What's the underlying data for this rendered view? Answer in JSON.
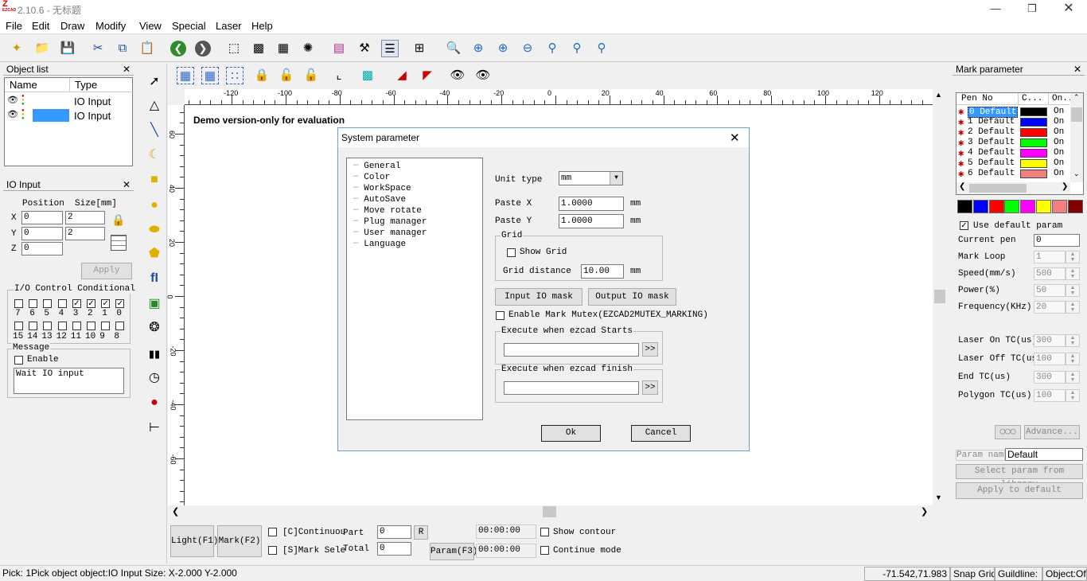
{
  "app": {
    "version": "2.10.6 - 无标题",
    "logo": "EZCAD"
  },
  "menu": [
    "File",
    "Edit",
    "Draw",
    "Modify",
    "View",
    "Special",
    "Laser",
    "Help"
  ],
  "object_list": {
    "title": "Object list",
    "col_name": "Name",
    "col_type": "Type",
    "rows": [
      {
        "type": "IO Input"
      },
      {
        "type": "IO Input"
      }
    ]
  },
  "io_input": {
    "title": "IO Input",
    "position": "Position",
    "size": "Size[mm]",
    "x": "0",
    "xs": "2",
    "y": "0",
    "ys": "2",
    "z": "0",
    "apply": "Apply",
    "io_title": "I/O Control Conditional",
    "bits_top": [
      "7",
      "6",
      "5",
      "4",
      "3",
      "2",
      "1",
      "0"
    ],
    "bits_bottom": [
      "15",
      "14",
      "13",
      "12",
      "11",
      "10",
      "9",
      "8"
    ],
    "message": "Message",
    "enable": "Enable",
    "wait": "Wait IO input"
  },
  "canvas": {
    "demo": "Demo version-only for evaluation",
    "ruler_h": [
      "-120",
      "-100",
      "-80",
      "-60",
      "-40",
      "-20",
      "0",
      "20",
      "40",
      "60",
      "80",
      "100",
      "120"
    ],
    "ruler_v": [
      "60",
      "40",
      "20",
      "0",
      "-20",
      "-40",
      "-60"
    ]
  },
  "dialog": {
    "title": "System parameter",
    "tree": [
      "General",
      "Color",
      "WorkSpace",
      "AutoSave",
      "Move rotate",
      "Plug manager",
      "User manager",
      "Language"
    ],
    "unit_type": "Unit type",
    "unit_val": "mm",
    "paste_x": "Paste X",
    "paste_x_val": "1.0000",
    "paste_y": "Paste Y",
    "paste_y_val": "1.0000",
    "mm": "mm",
    "grid": "Grid",
    "show_grid": "Show Grid",
    "grid_dist": "Grid distance",
    "grid_dist_val": "10.00",
    "input_io": "Input IO mask",
    "output_io": "Output IO mask",
    "mutex": "Enable Mark Mutex(EZCAD2MUTEX_MARKING)",
    "exec_start": "Execute when ezcad Starts",
    "exec_finish": "Execute when ezcad finish",
    "browse": ">>",
    "ok": "Ok",
    "cancel": "Cancel"
  },
  "bottom": {
    "light": "Light(F1)",
    "mark": "Mark(F2)",
    "continuous": "[C]Continuou",
    "part": "Part",
    "part_val": "0",
    "r": "R",
    "mark_sel": "[S]Mark Sele",
    "total": "Total",
    "total_val": "0",
    "param": "Param(F3)",
    "time1": "00:00:00",
    "time2": "00:00:00",
    "show_contour": "Show contour",
    "continue_mode": "Continue mode"
  },
  "mark_param": {
    "title": "Mark parameter",
    "col_pen": "Pen No",
    "col_c": "C...",
    "col_on": "On...",
    "pens": [
      {
        "no": "0 Default",
        "color": "#000000",
        "on": "On"
      },
      {
        "no": "1 Default",
        "color": "#0000ff",
        "on": "On"
      },
      {
        "no": "2 Default",
        "color": "#ff0000",
        "on": "On"
      },
      {
        "no": "3 Default",
        "color": "#00ff00",
        "on": "On"
      },
      {
        "no": "4 Default",
        "color": "#ff00ff",
        "on": "On"
      },
      {
        "no": "5 Default",
        "color": "#ffff00",
        "on": "On"
      },
      {
        "no": "6 Default",
        "color": "#f08080",
        "on": "On"
      }
    ],
    "palette": [
      "#000000",
      "#0000ff",
      "#ff0000",
      "#00ff00",
      "#ff00ff",
      "#ffff00",
      "#f08080",
      "#800000"
    ],
    "use_default": "Use default param",
    "current_pen": "Current pen",
    "current_pen_val": "0",
    "fields": [
      {
        "label": "Mark Loop",
        "val": "1"
      },
      {
        "label": "Speed(mm/s)",
        "val": "500"
      },
      {
        "label": "Power(%)",
        "val": "50"
      },
      {
        "label": "Frequency(KHz)",
        "val": "20"
      }
    ],
    "fields2": [
      {
        "label": "Laser On TC(us)",
        "val": "300"
      },
      {
        "label": "Laser Off TC(us",
        "val": "100"
      },
      {
        "label": "End TC(us)",
        "val": "300"
      },
      {
        "label": "Polygon TC(us)",
        "val": "100"
      }
    ],
    "advance": "Advance...",
    "param_name": "Param name",
    "param_name_val": "Default",
    "select_lib": "Select param from library",
    "apply_default": "Apply to default"
  },
  "status": {
    "pick": "Pick: 1Pick object object:IO Input Size: X-2.000 Y-2.000",
    "coords": "-71.542,71.983",
    "snap": "Snap Grid",
    "guide": "Guildline:",
    "object": "Object:Off"
  }
}
